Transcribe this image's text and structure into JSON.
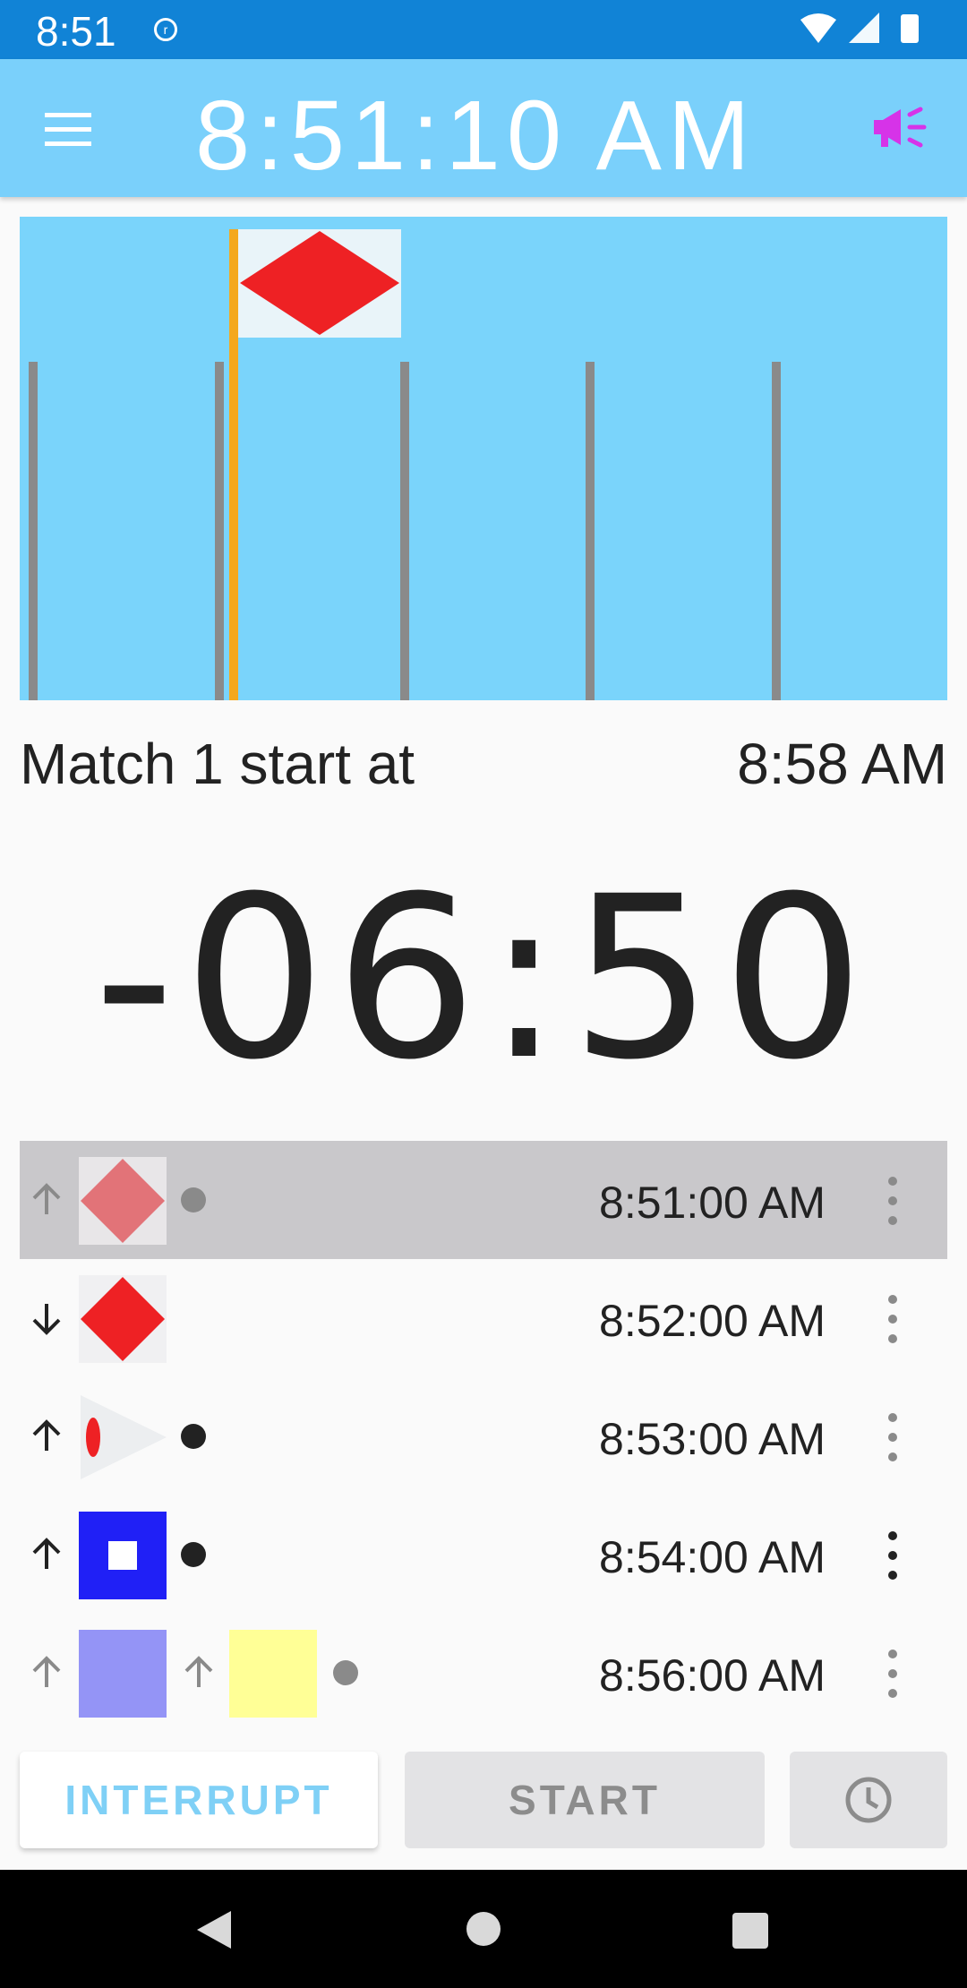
{
  "status_bar": {
    "time": "8:51"
  },
  "app_bar": {
    "clock": "8:51:10 AM"
  },
  "match": {
    "label": "Match 1 start at",
    "time": "8:58 AM"
  },
  "countdown": "-06:50",
  "schedule": [
    {
      "time": "8:51:00 AM",
      "direction": "up",
      "active": false
    },
    {
      "time": "8:52:00 AM",
      "direction": "down",
      "active": false
    },
    {
      "time": "8:53:00 AM",
      "direction": "up",
      "active": false
    },
    {
      "time": "8:54:00 AM",
      "direction": "up",
      "active": true
    },
    {
      "time": "8:56:00 AM",
      "direction": "up",
      "active": false
    }
  ],
  "buttons": {
    "interrupt": "INTERRUPT",
    "start": "START"
  },
  "colors": {
    "status_bar": "#1183d6",
    "app_bar": "#7ad0fb",
    "flag_red": "#ee2124",
    "flag_blue": "#2020f6",
    "flag_yellow": "#ffff96",
    "pole": "#8a8a8a",
    "pole_active": "#f4a81d",
    "horn": "#d633e8"
  }
}
